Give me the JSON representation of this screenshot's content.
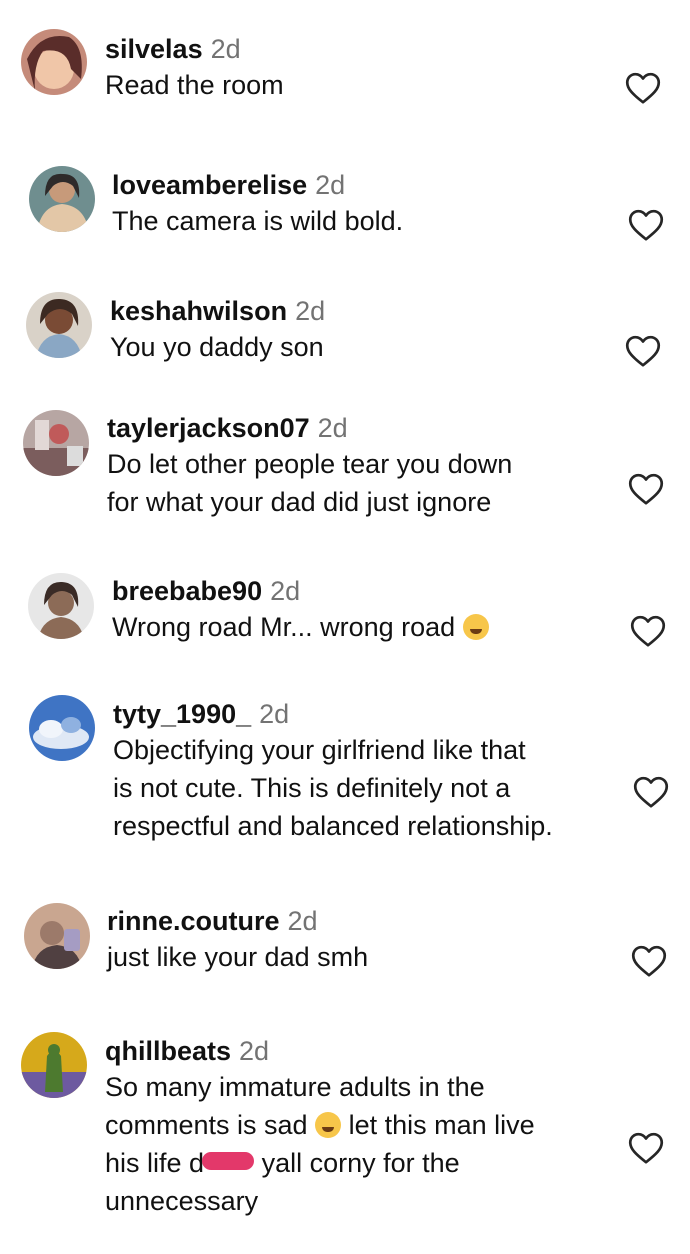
{
  "comments": [
    {
      "user": "silvelas",
      "time": "2d",
      "lines": [
        "Read the room"
      ],
      "avatar_colors": [
        "#c58b7a",
        "#5a2d2a",
        "#f0c6a8"
      ]
    },
    {
      "user": "loveamberelise",
      "time": "2d",
      "lines": [
        "The camera is wild bold."
      ],
      "avatar_colors": [
        "#e3c7a7",
        "#6f8e8f",
        "#2e2a2a"
      ]
    },
    {
      "user": "keshahwilson",
      "time": "2d",
      "lines": [
        "You yo daddy son"
      ],
      "avatar_colors": [
        "#7a4b35",
        "#d9d2c8",
        "#3c2a22"
      ]
    },
    {
      "user": "taylerjackson07",
      "time": "2d",
      "lines": [
        "Do let other people tear you down",
        "for what your dad did just ignore"
      ],
      "avatar_colors": [
        "#b7a6a3",
        "#7b5d5d",
        "#c05a5a"
      ]
    },
    {
      "user": "breebabe90",
      "time": "2d",
      "lines": [
        "Wrong road Mr... wrong road"
      ],
      "emoji": "weary-face-emoji",
      "avatar_colors": [
        "#e7e7e7",
        "#3a2b26",
        "#8c6b57"
      ]
    },
    {
      "user": "tyty_1990_",
      "time": "2d",
      "lines": [
        "Objectifying your girlfriend like that",
        "is not cute. This is definitely not a",
        "respectful and balanced relationship."
      ],
      "avatar_colors": [
        "#3f74c4",
        "#dfe8f5",
        "#8fb1e0"
      ]
    },
    {
      "user": "rinne.couture",
      "time": "2d",
      "lines": [
        "just like your dad smh"
      ],
      "avatar_colors": [
        "#c9a690",
        "#504041",
        "#a59cc3"
      ]
    },
    {
      "user": "qhillbeats",
      "time": "2d",
      "lines": [
        "So many immature adults in the",
        "comments is sad",
        "let this man live",
        "his life d",
        "yall corny for the",
        "unnecessary"
      ],
      "emoji": "laughing-tears-emoji",
      "avatar_colors": [
        "#d6a91b",
        "#4d7a2f",
        "#6d5aa0"
      ]
    }
  ],
  "icons": {
    "like": "heart-outline-icon"
  },
  "colors": {
    "username": "#111111",
    "timestamp": "#737373",
    "text": "#111111",
    "heart": "#262626",
    "redaction": "#e3386a"
  }
}
